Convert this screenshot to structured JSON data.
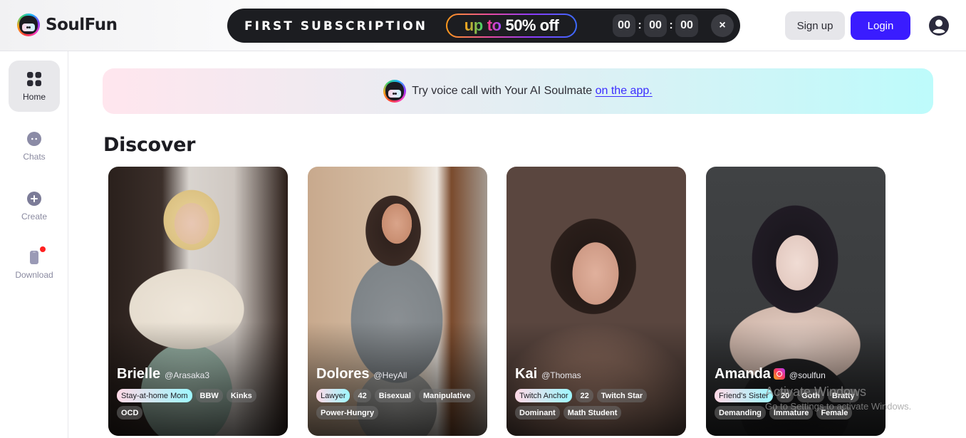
{
  "header": {
    "brand": "SoulFun",
    "promo": {
      "title": "FIRST SUBSCRIPTION",
      "badge_up": "up",
      "badge_to": "to",
      "badge_offer": "50% off",
      "timer": {
        "hours": "00",
        "minutes": "00",
        "seconds": "00",
        "separator": ":"
      },
      "close_label": "×"
    },
    "signup_label": "Sign up",
    "login_label": "Login",
    "account_icon": "user-circle-icon"
  },
  "sidebar": {
    "items": [
      {
        "label": "Home",
        "icon": "grid-icon",
        "active": true
      },
      {
        "label": "Chats",
        "icon": "chat-bubble-icon",
        "active": false
      },
      {
        "label": "Create",
        "icon": "plus-circle-icon",
        "active": false
      },
      {
        "label": "Download",
        "icon": "phone-icon",
        "active": false,
        "badge": true
      }
    ]
  },
  "banner": {
    "text": "Try voice call with Your AI Soulmate",
    "link": "on the app."
  },
  "discover": {
    "title": "Discover",
    "cards": [
      {
        "name": "Brielle",
        "handle": "@Arasaka3",
        "instagram": false,
        "tags": [
          "Stay-at-home Mom",
          "BBW",
          "Kinks",
          "OCD"
        ]
      },
      {
        "name": "Dolores",
        "handle": "@HeyAll",
        "instagram": false,
        "tags": [
          "Lawyer",
          "42",
          "Bisexual",
          "Manipulative",
          "Power-Hungry"
        ]
      },
      {
        "name": "Kai",
        "handle": "@Thomas",
        "instagram": false,
        "tags": [
          "Twitch Anchor",
          "22",
          "Twitch Star",
          "Dominant",
          "Math Student"
        ]
      },
      {
        "name": "Amanda",
        "handle": "@soulfun",
        "instagram": true,
        "tags": [
          "Friend's Sister",
          "20",
          "Goth",
          "Bratty",
          "Demanding",
          "Immature",
          "Female"
        ]
      }
    ]
  },
  "colors": {
    "accent": "#3a1cff",
    "promo_bg": "#1c1d21",
    "badge_red": "#ff2020"
  },
  "os_watermark": {
    "line1": "Activate Windows",
    "line2": "Go to Settings to activate Windows."
  }
}
